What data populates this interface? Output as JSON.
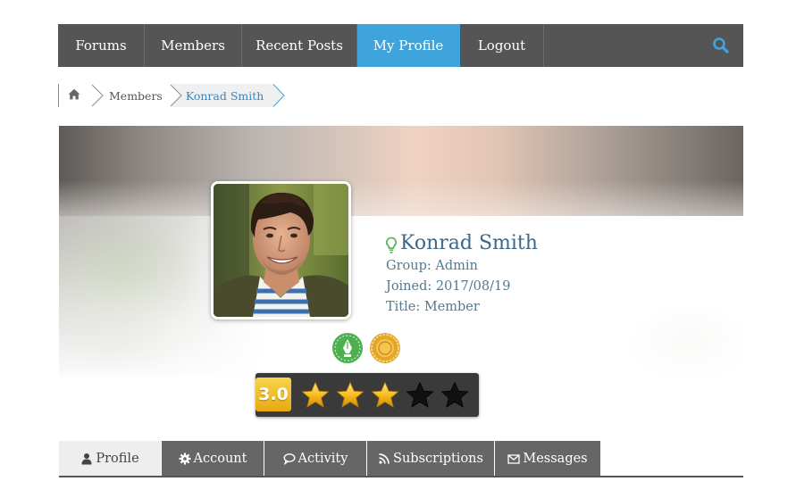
{
  "nav": {
    "items": [
      {
        "label": "Forums",
        "active": false
      },
      {
        "label": "Members",
        "active": false
      },
      {
        "label": "Recent Posts",
        "active": false
      },
      {
        "label": "My Profile",
        "active": true
      },
      {
        "label": "Logout",
        "active": false
      }
    ],
    "search_icon": "search-icon",
    "colors": {
      "bar": "#555555",
      "active": "#3fa4dc"
    }
  },
  "breadcrumb": {
    "home_icon": "home-icon",
    "items": [
      "Members",
      "Konrad Smith"
    ]
  },
  "profile": {
    "name": "Konrad Smith",
    "status_icon": "lightbulb-icon",
    "status_color": "#5cb85c",
    "group": "Group: Admin",
    "joined": "Joined: 2017/08/19",
    "title": "Title: Member",
    "badges": [
      {
        "icon": "pen-badge-icon",
        "color": "#4caf50"
      },
      {
        "icon": "gold-medal-icon",
        "color": "#e3a628"
      }
    ],
    "rating": {
      "score": "3.0",
      "value": 3,
      "max": 5
    }
  },
  "tabs": [
    {
      "label": "Profile",
      "icon": "user-icon",
      "active": true
    },
    {
      "label": "Account",
      "icon": "gear-icon",
      "active": false
    },
    {
      "label": "Activity",
      "icon": "comments-icon",
      "active": false
    },
    {
      "label": "Subscriptions",
      "icon": "rss-icon",
      "active": false
    },
    {
      "label": "Messages",
      "icon": "envelope-icon",
      "active": false
    }
  ]
}
